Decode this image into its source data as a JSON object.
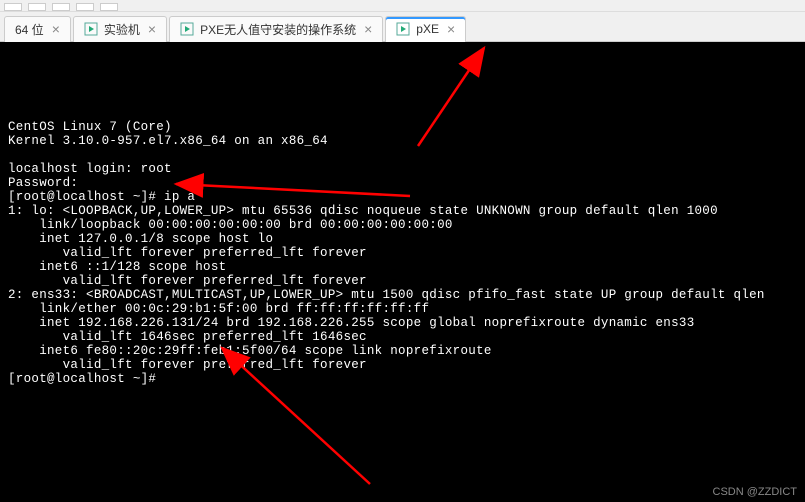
{
  "tabs": [
    {
      "label": "64 位",
      "active": false
    },
    {
      "label": "实验机",
      "active": false
    },
    {
      "label": "PXE无人值守安装的操作系统",
      "active": false
    },
    {
      "label": "pXE",
      "active": true
    }
  ],
  "terminal": {
    "os_line": "CentOS Linux 7 (Core)",
    "kernel_line": "Kernel 3.10.0-957.el7.x86_64 on an x86_64",
    "login_prompt": "localhost login: root",
    "password_prompt": "Password:",
    "prompt1": "[root@localhost ~]# ip a",
    "if1_header": "1: lo: <LOOPBACK,UP,LOWER_UP> mtu 65536 qdisc noqueue state UNKNOWN group default qlen 1000",
    "if1_link": "    link/loopback 00:00:00:00:00:00 brd 00:00:00:00:00:00",
    "if1_inet": "    inet 127.0.0.1/8 scope host lo",
    "if1_valid": "       valid_lft forever preferred_lft forever",
    "if1_inet6": "    inet6 ::1/128 scope host",
    "if1_valid6": "       valid_lft forever preferred_lft forever",
    "if2_header": "2: ens33: <BROADCAST,MULTICAST,UP,LOWER_UP> mtu 1500 qdisc pfifo_fast state UP group default qlen",
    "if2_link": "    link/ether 00:0c:29:b1:5f:00 brd ff:ff:ff:ff:ff:ff",
    "if2_inet": "    inet 192.168.226.131/24 brd 192.168.226.255 scope global noprefixroute dynamic ens33",
    "if2_valid": "       valid_lft 1646sec preferred_lft 1646sec",
    "if2_inet6": "    inet6 fe80::20c:29ff:feb1:5f00/64 scope link noprefixroute",
    "if2_valid6": "       valid_lft forever preferred_lft forever",
    "prompt2": "[root@localhost ~]#"
  },
  "annotations": {
    "arrow_color": "#ff0000"
  },
  "watermark": "CSDN @ZZDICT"
}
